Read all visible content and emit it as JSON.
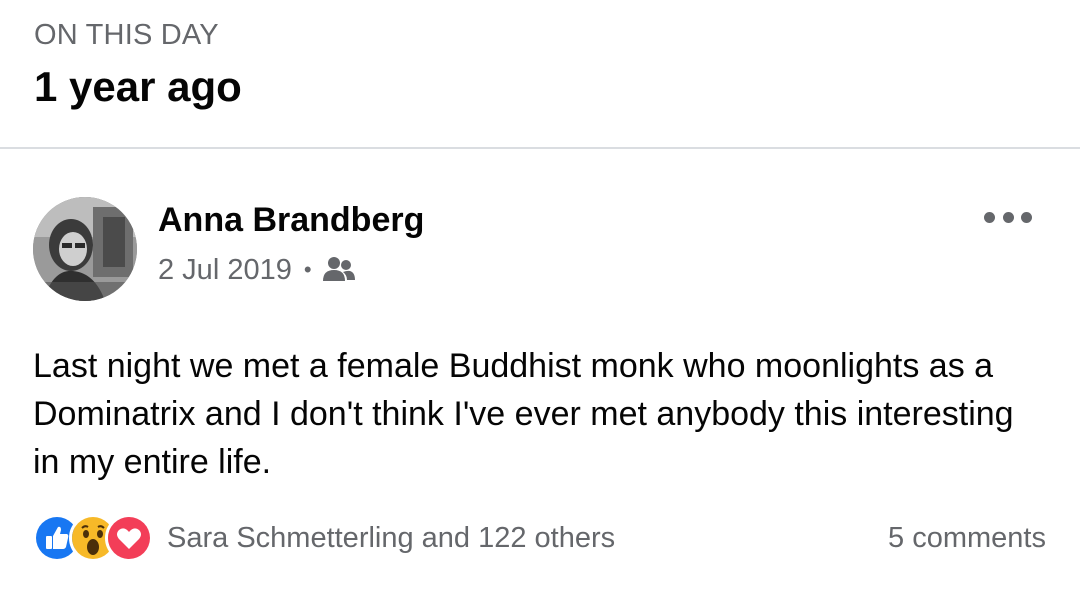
{
  "memories": {
    "section_label": "ON THIS DAY",
    "section_title": "1 year ago"
  },
  "post": {
    "author_name": "Anna Brandberg",
    "date": "2 Jul 2019",
    "separator": "•",
    "audience_icon": "friends-icon",
    "more_icon": "more-options-icon",
    "text": "Last night we met a female Buddhist monk who moonlights as a Dominatrix and I don't think I've ever met anybody this interesting in my entire life.",
    "reactions": [
      "like",
      "wow",
      "love"
    ],
    "reactions_summary": "Sara Schmetterling and 122 others",
    "comments_summary": "5 comments"
  },
  "colors": {
    "like_blue": "#1877f2",
    "wow_yellow": "#f7b928",
    "love_red": "#f33e58",
    "secondary_text": "#65676b",
    "divider": "#dadde1"
  }
}
